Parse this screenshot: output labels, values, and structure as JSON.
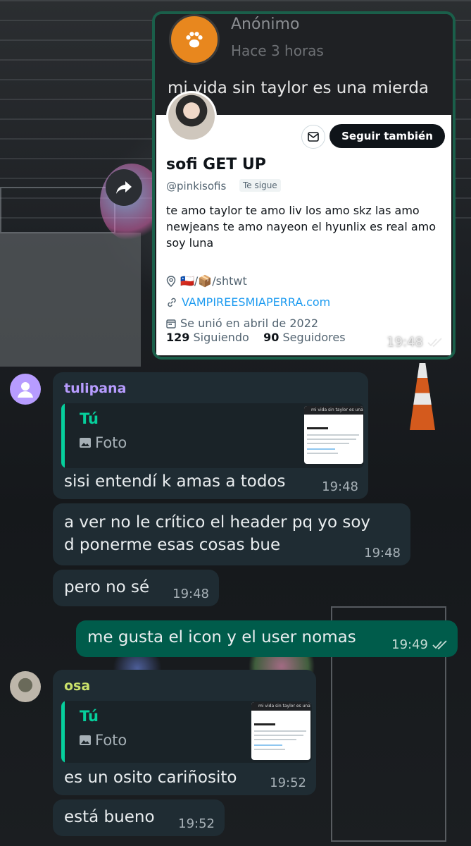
{
  "screenshot_card": {
    "anon_name": "Anónimo",
    "anon_time": "Hace 3 horas",
    "anon_text": "mi vida sin taylor es una mierda",
    "profile": {
      "follow_label": "Seguir también",
      "name": "sofi GET UP",
      "handle": "@pinkisofis",
      "follows_you": "Te sigue",
      "bio": "te amo taylor te amo liv los amo skz las amo newjeans te amo nayeon el hyunlix es real amo soy luna",
      "location": "🇨🇱/📦/shtwt",
      "website": "VAMPIREESMIAPERRA.com",
      "joined": "Se unió en abril de 2022",
      "following_count": "129",
      "following_label": "Siguiendo",
      "followers_count": "90",
      "followers_label": "Seguidores"
    },
    "time": "19:48"
  },
  "messages": [
    {
      "sender": "tulipana",
      "sender_color": "#b79cff",
      "quote_author": "Tú",
      "quote_type": "Foto",
      "thumb_title": "mi vida sin taylor es una mierda",
      "text": "sisi entendí k amas a todos",
      "time": "19:48"
    },
    {
      "text_line1": "a ver no le crítico el header pq yo soy",
      "text_line2": "d ponerme esas cosas bue",
      "time": "19:48"
    },
    {
      "text": "pero no sé",
      "time": "19:48"
    },
    {
      "text": "me gusta el icon y el user nomas",
      "time": "19:49"
    },
    {
      "sender": "osa",
      "sender_color": "#c9e06a",
      "quote_author": "Tú",
      "quote_type": "Foto",
      "thumb_title": "mi vida sin taylor es una mierda",
      "text": "es un osito cariñosito",
      "time": "19:52"
    },
    {
      "text": "está bueno",
      "time": "19:52"
    }
  ]
}
